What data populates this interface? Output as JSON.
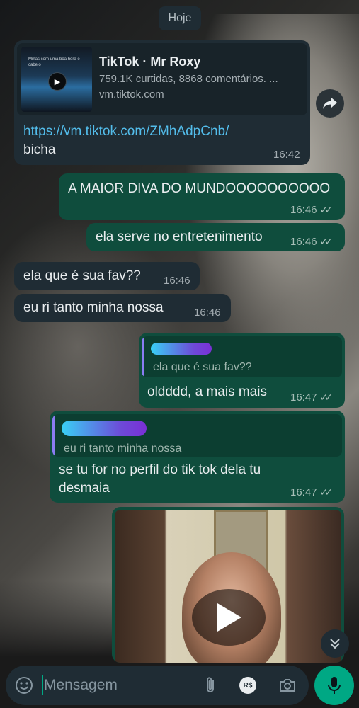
{
  "date_separator": "Hoje",
  "messages": {
    "m1": {
      "preview": {
        "title": "TikTok · Mr Roxy",
        "description": "759.1K curtidas, 8868 comentários. ...",
        "domain": "vm.tiktok.com",
        "thumbnail_caption": "Minas com uma boa hora e cabelo"
      },
      "link": "https://vm.tiktok.com/ZMhAdpCnb/",
      "text": "bicha",
      "time": "16:42"
    },
    "m2": {
      "text": "A MAIOR DIVA DO MUNDOOOOOOOOOO",
      "time": "16:46"
    },
    "m3": {
      "text": "ela serve no entretenimento",
      "time": "16:46"
    },
    "m4": {
      "text": "ela que é sua fav??",
      "time": "16:46"
    },
    "m5": {
      "text": "eu ri tanto minha nossa",
      "time": "16:46"
    },
    "m6": {
      "quote": "ela que é sua fav??",
      "text": "oldddd, a mais mais",
      "time": "16:47"
    },
    "m7": {
      "quote": "eu ri tanto minha nossa",
      "text": "se tu for no perfil do tik tok dela tu desmaia",
      "time": "16:47"
    }
  },
  "read_ticks": "✓✓",
  "input": {
    "placeholder": "Mensagem",
    "value": ""
  },
  "icons": {
    "forward": "forward-icon",
    "scroll": "double-chevron-down-icon",
    "emoji": "emoji-icon",
    "attach": "paperclip-icon",
    "payment": "rs-payment-icon",
    "camera": "camera-icon",
    "mic": "microphone-icon",
    "play": "play-icon"
  },
  "payment_label": "R$",
  "colors": {
    "incoming_bubble": "#1f2c34",
    "outgoing_bubble": "#0f4d3d",
    "link": "#53bdeb",
    "accent": "#00a884"
  }
}
